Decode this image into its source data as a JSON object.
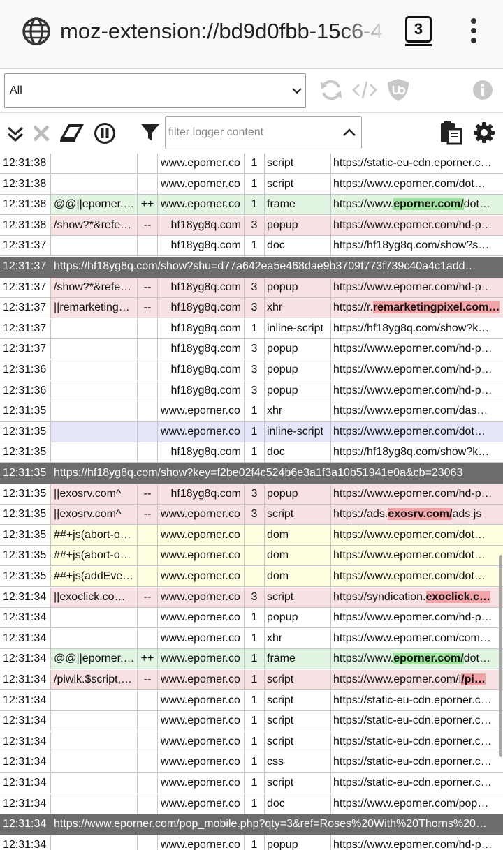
{
  "browser": {
    "url": "moz-extension://bd9d0fbb-15c6-4",
    "tab_count": "3"
  },
  "toolbar": {
    "tab_select_value": "All"
  },
  "filter": {
    "placeholder": "filter logger content"
  },
  "icons": {
    "site": "globe-icon",
    "menu": "kebab-menu-icon",
    "reload": "reload-icon",
    "source": "code-icon",
    "ublock": "ublock-shield-icon",
    "info": "info-icon",
    "expand": "double-chevron-down-icon",
    "clear": "clear-x-icon",
    "erase": "eraser-icon",
    "pause": "pause-icon",
    "filter": "funnel-icon",
    "filter_options": "chevron-up-icon",
    "export": "clipboard-export-icon",
    "settings": "gear-icon"
  },
  "colors": {
    "allowed_bg": "#e2f4e2",
    "blocked_bg": "#f7e1e3",
    "cosmetic_bg": "#fefee0",
    "separator_bg": "#6c6c6c",
    "allowed_highlight": "#9fe39f",
    "blocked_highlight": "#f2a3a8"
  },
  "rows": [
    {
      "time": "12:31:38",
      "filter": "",
      "act": "",
      "ctx": "www.eporner.co",
      "party": "1",
      "type": "script",
      "url": "https://static-eu-cdn.eporner.c…",
      "style": ""
    },
    {
      "time": "12:31:38",
      "filter": "",
      "act": "",
      "ctx": "www.eporner.co",
      "party": "1",
      "type": "script",
      "url": "https://www.eporner.com/dot…",
      "style": ""
    },
    {
      "time": "12:31:38",
      "filter": "@@||eporner.…",
      "act": "++",
      "ctx": "www.eporner.co",
      "party": "1",
      "type": "frame",
      "url_pre": "https://www.",
      "url_hl": "eporner.com/",
      "url_post": "dot…",
      "style": "allowed"
    },
    {
      "time": "12:31:38",
      "filter": "/show?*&refe…",
      "act": "--",
      "ctx": "hf18yg8q.com",
      "party": "3",
      "type": "popup",
      "url": "https://www.eporner.com/hd-p…",
      "style": "blocked"
    },
    {
      "time": "12:31:37",
      "filter": "",
      "act": "",
      "ctx": "hf18yg8q.com",
      "party": "1",
      "type": "doc",
      "url": "https://hf18yg8q.com/show?s…",
      "style": ""
    },
    {
      "kind": "sep",
      "time": "12:31:37",
      "url": "https://hf18yg8q.com/show?shu=d77a642ea5e468dae9b3709f773f739c40a4c1add…"
    },
    {
      "time": "12:31:37",
      "filter": "/show?*&refe…",
      "act": "--",
      "ctx": "hf18yg8q.com",
      "party": "3",
      "type": "popup",
      "url": "https://www.eporner.com/hd-p…",
      "style": "blocked"
    },
    {
      "time": "12:31:37",
      "filter": "||remarketing…",
      "act": "--",
      "ctx": "hf18yg8q.com",
      "party": "3",
      "type": "xhr",
      "url_pre": "https://r.",
      "url_hl": "remarketingpixel.com…",
      "url_post": "",
      "style": "blocked"
    },
    {
      "time": "12:31:37",
      "filter": "",
      "act": "",
      "ctx": "hf18yg8q.com",
      "party": "1",
      "type": "inline-script",
      "url": "https://hf18yg8q.com/show?k…",
      "style": ""
    },
    {
      "time": "12:31:37",
      "filter": "",
      "act": "",
      "ctx": "hf18yg8q.com",
      "party": "3",
      "type": "popup",
      "url": "https://www.eporner.com/hd-p…",
      "style": ""
    },
    {
      "time": "12:31:36",
      "filter": "",
      "act": "",
      "ctx": "hf18yg8q.com",
      "party": "3",
      "type": "popup",
      "url": "https://www.eporner.com/hd-p…",
      "style": ""
    },
    {
      "time": "12:31:36",
      "filter": "",
      "act": "",
      "ctx": "hf18yg8q.com",
      "party": "3",
      "type": "popup",
      "url": "https://www.eporner.com/hd-p…",
      "style": ""
    },
    {
      "time": "12:31:35",
      "filter": "",
      "act": "",
      "ctx": "www.eporner.co",
      "party": "1",
      "type": "xhr",
      "url": "https://www.eporner.com/das…",
      "style": ""
    },
    {
      "time": "12:31:35",
      "filter": "",
      "act": "",
      "ctx": "www.eporner.co",
      "party": "1",
      "type": "inline-script",
      "url": "https://www.eporner.com/dot…",
      "style": "lavender"
    },
    {
      "time": "12:31:35",
      "filter": "",
      "act": "",
      "ctx": "hf18yg8q.com",
      "party": "1",
      "type": "doc",
      "url": "https://hf18yg8q.com/show?k…",
      "style": ""
    },
    {
      "kind": "sep",
      "time": "12:31:35",
      "url": "https://hf18yg8q.com/show?key=f2be02f4c524b6e3a1f3a10b51941e0a&cb=23063"
    },
    {
      "time": "12:31:35",
      "filter": "||exosrv.com^",
      "act": "--",
      "ctx": "hf18yg8q.com",
      "party": "3",
      "type": "popup",
      "url": "https://www.eporner.com/hd-p…",
      "style": "blocked"
    },
    {
      "time": "12:31:35",
      "filter": "||exosrv.com^",
      "act": "--",
      "ctx": "www.eporner.co",
      "party": "3",
      "type": "script",
      "url_pre": "https://ads.",
      "url_hl": "exosrv.com/",
      "url_post": "ads.js",
      "style": "blocked"
    },
    {
      "time": "12:31:35",
      "filter": "##+js(abort-o…",
      "act": "",
      "ctx": "www.eporner.co",
      "party": "",
      "type": "dom",
      "url": "https://www.eporner.com/dot…",
      "style": "cosmetic"
    },
    {
      "time": "12:31:35",
      "filter": "##+js(abort-o…",
      "act": "",
      "ctx": "www.eporner.co",
      "party": "",
      "type": "dom",
      "url": "https://www.eporner.com/dot…",
      "style": "cosmetic"
    },
    {
      "time": "12:31:35",
      "filter": "##+js(addEve…",
      "act": "",
      "ctx": "www.eporner.co",
      "party": "",
      "type": "dom",
      "url": "https://www.eporner.com/dot…",
      "style": "cosmetic"
    },
    {
      "time": "12:31:34",
      "filter": "||exoclick.co…",
      "act": "--",
      "ctx": "www.eporner.co",
      "party": "3",
      "type": "script",
      "url_pre": "https://syndication.",
      "url_hl": "exoclick.c…",
      "url_post": "",
      "style": "blocked"
    },
    {
      "time": "12:31:34",
      "filter": "",
      "act": "",
      "ctx": "www.eporner.co",
      "party": "1",
      "type": "popup",
      "url": "https://www.eporner.com/hd-p…",
      "style": ""
    },
    {
      "time": "12:31:34",
      "filter": "",
      "act": "",
      "ctx": "www.eporner.co",
      "party": "1",
      "type": "xhr",
      "url": "https://www.eporner.com/com…",
      "style": ""
    },
    {
      "time": "12:31:34",
      "filter": "@@||eporner.…",
      "act": "++",
      "ctx": "www.eporner.co",
      "party": "1",
      "type": "frame",
      "url_pre": "https://www.",
      "url_hl": "eporner.com/",
      "url_post": "dot…",
      "style": "allowed"
    },
    {
      "time": "12:31:34",
      "filter": "/piwik.$script,…",
      "act": "--",
      "ctx": "www.eporner.co",
      "party": "1",
      "type": "script",
      "url_pre": "https://www.eporner.com/i",
      "url_hl": "/pi…",
      "url_post": "",
      "style": "blocked"
    },
    {
      "time": "12:31:34",
      "filter": "",
      "act": "",
      "ctx": "www.eporner.co",
      "party": "1",
      "type": "script",
      "url": "https://static-eu-cdn.eporner.c…",
      "style": ""
    },
    {
      "time": "12:31:34",
      "filter": "",
      "act": "",
      "ctx": "www.eporner.co",
      "party": "1",
      "type": "script",
      "url": "https://static-eu-cdn.eporner.c…",
      "style": ""
    },
    {
      "time": "12:31:34",
      "filter": "",
      "act": "",
      "ctx": "www.eporner.co",
      "party": "1",
      "type": "script",
      "url": "https://static-eu-cdn.eporner.c…",
      "style": ""
    },
    {
      "time": "12:31:34",
      "filter": "",
      "act": "",
      "ctx": "www.eporner.co",
      "party": "1",
      "type": "css",
      "url": "https://static-eu-cdn.eporner.c…",
      "style": ""
    },
    {
      "time": "12:31:34",
      "filter": "",
      "act": "",
      "ctx": "www.eporner.co",
      "party": "1",
      "type": "script",
      "url": "https://static-eu-cdn.eporner.c…",
      "style": ""
    },
    {
      "time": "12:31:34",
      "filter": "",
      "act": "",
      "ctx": "www.eporner.co",
      "party": "1",
      "type": "doc",
      "url": "https://www.eporner.com/pop…",
      "style": ""
    },
    {
      "kind": "sep",
      "time": "12:31:34",
      "url": "https://www.eporner.com/pop_mobile.php?qty=3&ref=Roses%20With%20Thorns%20…"
    },
    {
      "time": "12:31:34",
      "filter": "",
      "act": "",
      "ctx": "www.eporner.co",
      "party": "1",
      "type": "popup",
      "url": "https://www.eporner.com/hd-p…",
      "style": ""
    }
  ]
}
